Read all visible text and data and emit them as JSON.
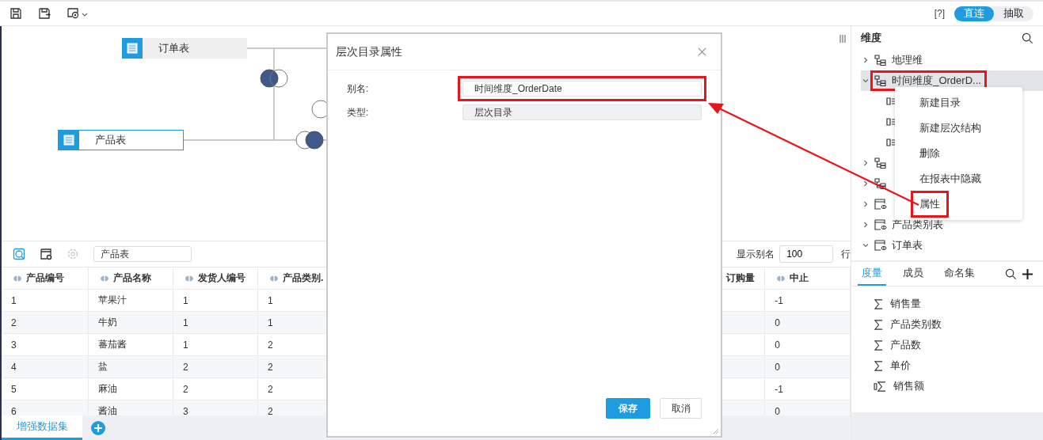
{
  "toolbar": {
    "help": "[?]",
    "modes": [
      {
        "label": "直连",
        "selected": true
      },
      {
        "label": "抽取",
        "selected": false
      }
    ]
  },
  "canvas": {
    "tables": [
      {
        "name": "订单表",
        "selected": false
      },
      {
        "name": "产品表",
        "selected": true
      }
    ]
  },
  "dataset": {
    "search": {
      "value": "产品表"
    },
    "alias_label": "显示别名",
    "row_count": "100",
    "rows_unit": "行",
    "columns": [
      {
        "label": "产品编号"
      },
      {
        "label": "产品名称"
      },
      {
        "label": "发货人编号"
      },
      {
        "label": "产品类别."
      },
      {
        "label": "订购量"
      },
      {
        "label": "中止"
      }
    ],
    "rows": [
      [
        "1",
        "苹果汁",
        "1",
        "1",
        null,
        "-1"
      ],
      [
        "2",
        "牛奶",
        "1",
        "1",
        null,
        "0"
      ],
      [
        "3",
        "蕃茄酱",
        "1",
        "2",
        null,
        "0"
      ],
      [
        "4",
        "盐",
        "2",
        "2",
        null,
        "0"
      ],
      [
        "5",
        "麻油",
        "2",
        "2",
        null,
        "-1"
      ],
      [
        "6",
        "酱油",
        "3",
        "2",
        null,
        "0"
      ]
    ]
  },
  "sheet_tabs": [
    {
      "label": "增强数据集",
      "selected": true
    }
  ],
  "dialog": {
    "title": "层次目录属性",
    "fields": [
      {
        "label": "别名:",
        "value": "时间维度_OrderDate",
        "disabled": false,
        "highlighted": true
      },
      {
        "label": "类型:",
        "value": "层次目录",
        "disabled": true,
        "highlighted": false
      }
    ],
    "buttons": [
      {
        "label": "保存",
        "kind": "primary"
      },
      {
        "label": "取消",
        "kind": "secondary"
      }
    ]
  },
  "dimensions": {
    "title": "维度",
    "items": [
      {
        "label": "地理维",
        "kind": "hierarchy",
        "expanded": false,
        "selected": false,
        "highlighted": false
      },
      {
        "label": "时间维度_OrderD...",
        "kind": "hierarchy",
        "expanded": true,
        "selected": true,
        "highlighted": true,
        "children": [
          {
            "kind": "level"
          },
          {
            "kind": "level"
          },
          {
            "kind": "level"
          }
        ]
      },
      {
        "kind": "hierarchy",
        "expanded": false,
        "selected": false,
        "highlighted": false
      },
      {
        "kind": "hierarchy",
        "expanded": false,
        "selected": false,
        "highlighted": false
      },
      {
        "kind": "table",
        "expanded": false,
        "selected": false,
        "highlighted": false
      },
      {
        "label": "产品类别表",
        "kind": "table",
        "expanded": false,
        "selected": false,
        "highlighted": false
      },
      {
        "label": "订单表",
        "kind": "table",
        "expanded": true,
        "selected": false,
        "highlighted": false
      }
    ]
  },
  "context_menu": {
    "items": [
      {
        "label": "新建目录",
        "highlighted": false
      },
      {
        "label": "新建层次结构",
        "highlighted": false
      },
      {
        "label": "删除",
        "highlighted": false
      },
      {
        "label": "在报表中隐藏",
        "highlighted": false
      },
      {
        "label": "属性",
        "highlighted": true
      }
    ]
  },
  "measures": {
    "tabs": [
      {
        "label": "度量",
        "selected": true
      },
      {
        "label": "成员",
        "selected": false
      },
      {
        "label": "命名集",
        "selected": false
      }
    ],
    "items": [
      {
        "label": "销售量",
        "kind": "sum"
      },
      {
        "label": "产品类别数",
        "kind": "sum"
      },
      {
        "label": "产品数",
        "kind": "sum"
      },
      {
        "label": "单价",
        "kind": "sum"
      },
      {
        "label": "销售额",
        "kind": "calculated"
      }
    ]
  }
}
